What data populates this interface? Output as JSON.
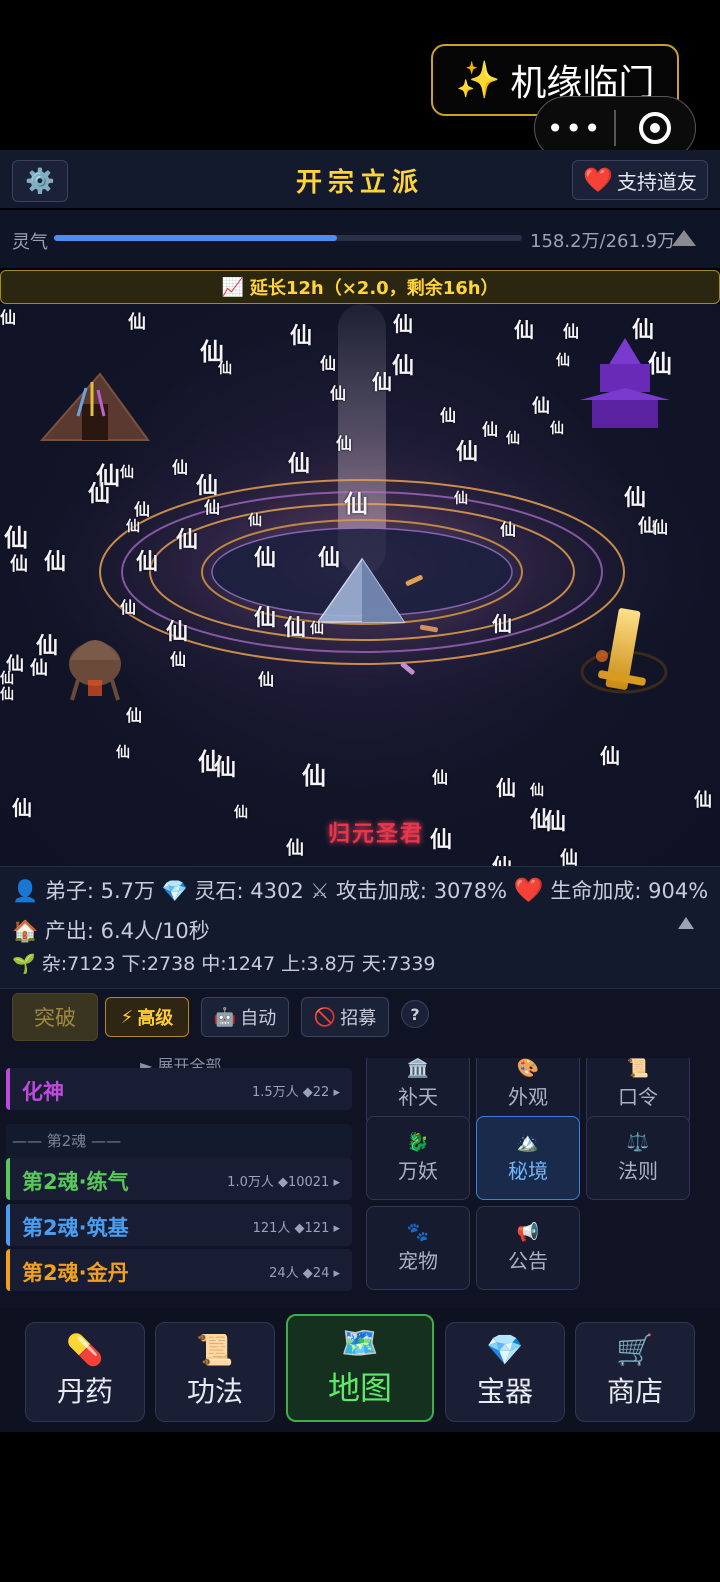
{
  "system": {
    "fortune_label": "机缘临门",
    "fortune_icon": "✨",
    "more_label": "•••"
  },
  "header": {
    "title": "开宗立派",
    "settings_icon": "⚙️",
    "support_label": "支持道友",
    "support_icon": "❤️"
  },
  "qi": {
    "label": "灵气",
    "value": "158.2万/261.9万",
    "progress": 0.604
  },
  "boost": {
    "icon": "📈",
    "text": "延长12h（×2.0，剩余16h）"
  },
  "scene": {
    "glyph": "仙",
    "realm_name": "归元圣君"
  },
  "stats": {
    "disciples": "弟子: 5.7万",
    "spirit_stones": "灵石: 4302",
    "attack_bonus": "攻击加成: 3078%",
    "life_bonus": "生命加成: 904%",
    "output": "产出: 6.4人/10秒",
    "tiers": "杂:7123 下:2738 中:1247 上:3.8万 天:7339"
  },
  "actions": {
    "breakthrough": "突破",
    "advanced": "高级",
    "auto": "自动",
    "recruit": "招募",
    "help": "?"
  },
  "realm_list": {
    "expand_all": "► 展开全部",
    "items": [
      {
        "name": "化神",
        "meta": "1.5万人 ◆22 ▸",
        "color": "#c04adf"
      },
      {
        "name": "第2魂·练气",
        "meta": "1.0万人 ◆10021 ▸",
        "color": "#58c85a"
      },
      {
        "name": "第2魂·筑基",
        "meta": "121人 ◆121 ▸",
        "color": "#4a9ef0"
      },
      {
        "name": "第2魂·金丹",
        "meta": "24人 ◆24 ▸",
        "color": "#f0a020"
      }
    ],
    "group_header": "—— 第2魂 ——"
  },
  "features": [
    {
      "label": "补天",
      "icon": "🏛️"
    },
    {
      "label": "外观",
      "icon": "🎨"
    },
    {
      "label": "口令",
      "icon": "📜"
    },
    {
      "label": "万妖",
      "icon": "🐉"
    },
    {
      "label": "秘境",
      "icon": "🏔️"
    },
    {
      "label": "法则",
      "icon": "⚖️"
    },
    {
      "label": "宠物",
      "icon": "🐾"
    },
    {
      "label": "公告",
      "icon": "📢"
    }
  ],
  "nav": [
    {
      "label": "丹药",
      "icon": "💊"
    },
    {
      "label": "功法",
      "icon": "📜"
    },
    {
      "label": "地图",
      "icon": "🗺️"
    },
    {
      "label": "宝器",
      "icon": "💎"
    },
    {
      "label": "商店",
      "icon": "🛒"
    }
  ],
  "icons": {
    "user": "👤",
    "gem": "💎",
    "sword": "⚔",
    "heart": "❤️",
    "home": "🏠",
    "sprout": "🌱",
    "bolt": "⚡",
    "robot": "🤖",
    "forbid": "🚫"
  }
}
